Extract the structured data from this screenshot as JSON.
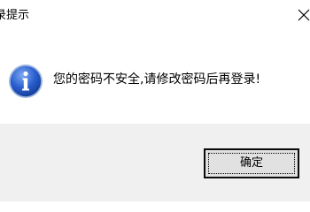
{
  "dialog": {
    "title": "录提示",
    "message": "您的密码不安全,请修改密码后再登录!",
    "ok_label": "确定"
  },
  "icons": {
    "info": "info-icon",
    "close": "close-icon"
  },
  "colors": {
    "icon_blue": "#1f54c4",
    "footer_bg": "#f0f0f0",
    "button_bg": "#e1e1e1"
  }
}
